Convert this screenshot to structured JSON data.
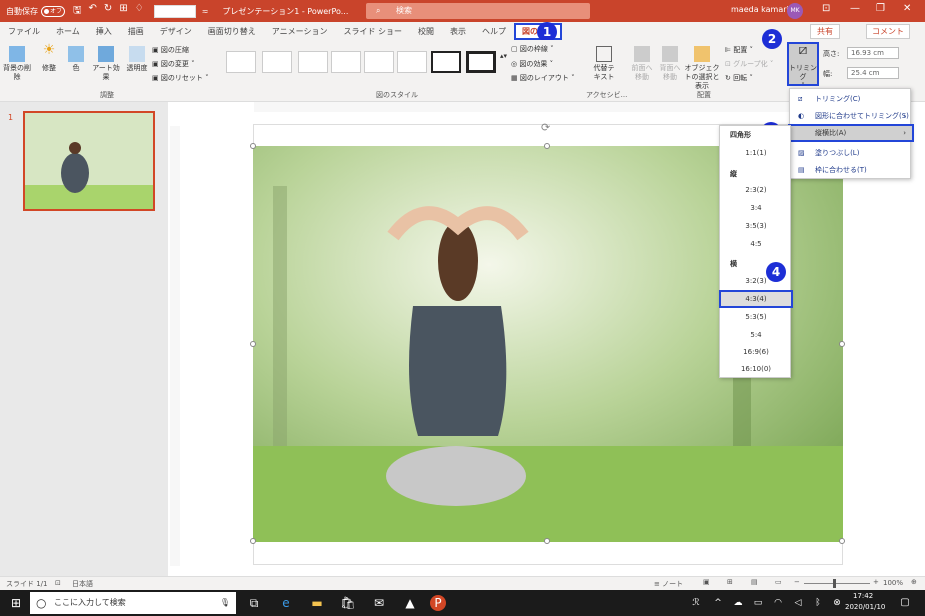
{
  "titlebar": {
    "autosave": "自動保存",
    "autosave_state": "オフ",
    "doc_title": "プレゼンテーション1 - PowerPo...",
    "search_placeholder": "検索",
    "user": "maeda kamari",
    "avatar": "MK"
  },
  "tabs": [
    "ファイル",
    "ホーム",
    "挿入",
    "描画",
    "デザイン",
    "画面切り替え",
    "アニメーション",
    "スライド ショー",
    "校閲",
    "表示",
    "ヘルプ",
    "図の形式"
  ],
  "share": "共有",
  "comment": "コメント",
  "ribbon": {
    "remove_bg": "背景の削除",
    "corrections": "修整",
    "color": "色",
    "art_effects": "アート効果",
    "transparency": "透明度",
    "compress": "図の圧縮",
    "change": "図の変更",
    "reset": "図のリセット",
    "group_adjust": "調整",
    "group_styles": "図のスタイル",
    "border": "図の枠線",
    "effects": "図の効果",
    "layout": "図のレイアウト",
    "alt_text": "代替テキスト",
    "group_access": "アクセシビ...",
    "bring_forward": "前面へ移動",
    "send_backward": "背面へ移動",
    "selection_pane": "オブジェクトの選択と表示",
    "align": "配置",
    "group": "グループ化",
    "rotate": "回転",
    "group_arrange": "配置",
    "crop": "トリミング",
    "height_label": "高さ:",
    "height": "16.93 cm",
    "width_label": "幅:",
    "width": "25.4 cm"
  },
  "badges": [
    "1",
    "2",
    "3",
    "4"
  ],
  "slide_number": "1",
  "crop_menu": [
    "トリミング(C)",
    "図形に合わせてトリミング(S)",
    "縦横比(A)",
    "塗りつぶし(L)",
    "枠に合わせる(T)"
  ],
  "aspect_menu": {
    "square_head": "四角形",
    "square": [
      "1:1(1)"
    ],
    "portrait_head": "縦",
    "portrait": [
      "2:3(2)",
      "3:4",
      "3:5(3)",
      "4:5"
    ],
    "landscape_head": "横",
    "landscape": [
      "3:2(3)",
      "4:3(4)",
      "5:3(5)",
      "5:4",
      "16:9(6)",
      "16:10(0)"
    ]
  },
  "status": {
    "slide": "スライド 1/1",
    "lang": "日本語",
    "notes": "ノート",
    "zoom": "100%"
  },
  "taskbar": {
    "search": "ここに入力して検索",
    "time": "17:42",
    "date": "2020/01/10"
  }
}
